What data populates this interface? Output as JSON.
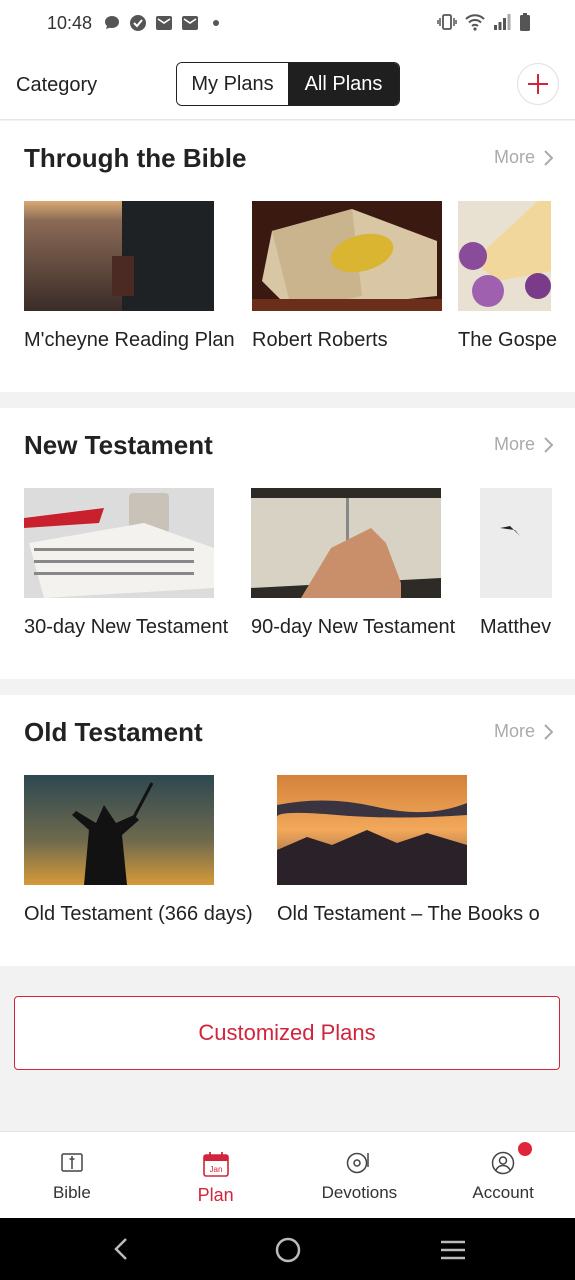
{
  "status": {
    "time": "10:48"
  },
  "header": {
    "category_label": "Category",
    "tabs": [
      {
        "label": "My Plans",
        "active": false
      },
      {
        "label": "All Plans",
        "active": true
      }
    ],
    "add_icon": "plus-icon"
  },
  "sections": [
    {
      "title": "Through the Bible",
      "more_label": "More",
      "items": [
        {
          "label": "M'cheyne Reading Plan"
        },
        {
          "label": "Robert Roberts"
        },
        {
          "label": "The Gospe"
        }
      ]
    },
    {
      "title": "New Testament",
      "more_label": "More",
      "items": [
        {
          "label": "30-day New Testament"
        },
        {
          "label": "90-day New Testament"
        },
        {
          "label": "Matthev"
        }
      ]
    },
    {
      "title": "Old Testament",
      "more_label": "More",
      "items": [
        {
          "label": "Old Testament (366 days)"
        },
        {
          "label": "Old Testament – The Books o"
        }
      ]
    }
  ],
  "customized_plans_label": "Customized Plans",
  "bottom_nav": [
    {
      "label": "Bible",
      "icon": "book-icon",
      "active": false
    },
    {
      "label": "Plan",
      "icon": "calendar-icon",
      "active": true,
      "icon_text": "Jan"
    },
    {
      "label": "Devotions",
      "icon": "record-icon",
      "active": false
    },
    {
      "label": "Account",
      "icon": "user-icon",
      "active": false,
      "has_badge": true
    }
  ],
  "colors": {
    "accent": "#d0253c",
    "dark": "#1f1f1f"
  }
}
